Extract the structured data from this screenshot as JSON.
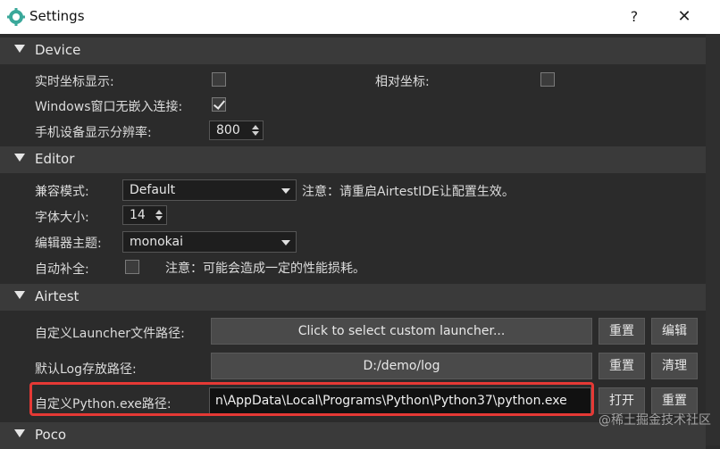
{
  "window": {
    "title": "Settings",
    "help_glyph": "?",
    "close_glyph": "✕"
  },
  "sections": {
    "device": {
      "title": "Device",
      "realtime_coords_label": "实时坐标显示:",
      "realtime_coords_checked": false,
      "relative_coords_label": "相对坐标:",
      "relative_coords_checked": false,
      "windows_no_embed_label": "Windows窗口无嵌入连接:",
      "windows_no_embed_checked": true,
      "resolution_label": "手机设备显示分辨率:",
      "resolution_value": "800"
    },
    "editor": {
      "title": "Editor",
      "compat_mode_label": "兼容模式:",
      "compat_mode_value": "Default",
      "compat_note": "注意：请重启AirtestIDE让配置生效。",
      "font_size_label": "字体大小:",
      "font_size_value": "14",
      "theme_label": "编辑器主题:",
      "theme_value": "monokai",
      "autocomplete_label": "自动补全:",
      "autocomplete_checked": false,
      "autocomplete_note": "注意：可能会造成一定的性能损耗。"
    },
    "airtest": {
      "title": "Airtest",
      "launcher_label": "自定义Launcher文件路径:",
      "launcher_placeholder": "Click to select custom launcher...",
      "launcher_reset": "重置",
      "launcher_edit": "编辑",
      "log_label": "默认Log存放路径:",
      "log_value": "D:/demo/log",
      "log_reset": "重置",
      "log_clear": "清理",
      "python_label": "自定义Python.exe路径:",
      "python_value": "n\\AppData\\Local\\Programs\\Python\\Python37\\python.exe",
      "python_open": "打开",
      "python_reset": "重置"
    },
    "poco": {
      "title": "Poco"
    }
  },
  "watermark": "@稀土掘金技术社区",
  "colors": {
    "highlight": "#e53935",
    "background": "#2b2b2b",
    "section_header": "#3a3a3a"
  }
}
